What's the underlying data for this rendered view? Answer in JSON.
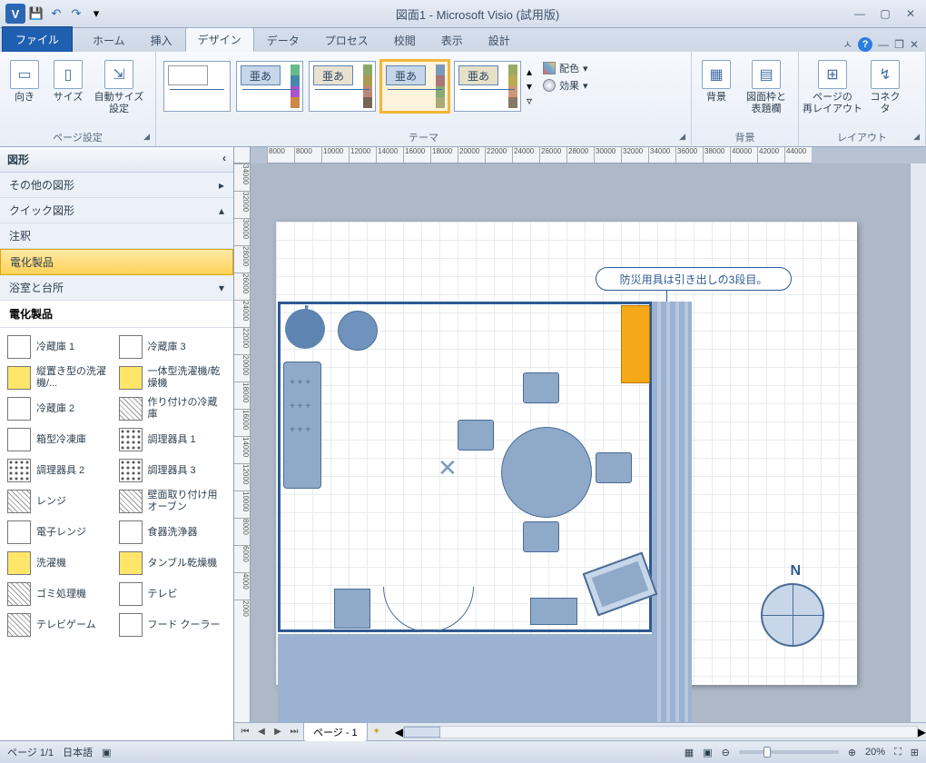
{
  "title": "図面1 - Microsoft Visio (試用版)",
  "qat": {
    "save": "💾",
    "undo": "↶",
    "redo": "↷"
  },
  "tabs": {
    "file": "ファイル",
    "home": "ホーム",
    "insert": "挿入",
    "design": "デザイン",
    "data": "データ",
    "process": "プロセス",
    "review": "校閲",
    "view": "表示",
    "plan": "設計"
  },
  "ribbon": {
    "pageSetup": {
      "orient": "向き",
      "size": "サイズ",
      "autosize": "自動サイズ\n設定",
      "group": "ページ設定"
    },
    "themes": {
      "aa": "亜あ",
      "group": "テーマ",
      "colors": "配色",
      "effects": "効果"
    },
    "background": {
      "bg": "背景",
      "border": "図面枠と\n表題欄",
      "group": "背景"
    },
    "layout": {
      "relayout": "ページの\n再レイアウト",
      "connector": "コネクタ",
      "group": "レイアウト"
    }
  },
  "shapesPane": {
    "title": "図形",
    "sections": {
      "other": "その他の図形",
      "quick": "クイック図形",
      "notes": "注釈",
      "elec": "電化製品",
      "bath": "浴室と台所"
    },
    "subtitle": "電化製品",
    "items": [
      [
        "冷蔵庫 1",
        "冷蔵庫 3"
      ],
      [
        "縦置き型の洗濯機/...",
        "一体型洗濯機/乾燥機"
      ],
      [
        "冷蔵庫 2",
        "作り付けの冷蔵庫"
      ],
      [
        "箱型冷凍庫",
        "調理器具 1"
      ],
      [
        "調理器具 2",
        "調理器具 3"
      ],
      [
        "レンジ",
        "壁面取り付け用オーブン"
      ],
      [
        "電子レンジ",
        "食器洗浄器"
      ],
      [
        "洗濯機",
        "タンブル乾燥機"
      ],
      [
        "ゴミ処理機",
        "テレビ"
      ],
      [
        "テレビゲーム",
        "フード クーラー"
      ]
    ]
  },
  "canvas": {
    "rulerH": [
      "8000",
      "8000",
      "10000",
      "12000",
      "14000",
      "16000",
      "18000",
      "20000",
      "22000",
      "24000",
      "26000",
      "28000",
      "30000",
      "32000",
      "34000",
      "36000",
      "38000",
      "40000",
      "42000",
      "44000"
    ],
    "rulerV": [
      "34000",
      "32000",
      "30000",
      "28000",
      "26000",
      "24000",
      "22000",
      "20000",
      "18000",
      "16000",
      "14000",
      "12000",
      "10000",
      "8000",
      "6000",
      "4000",
      "2000"
    ],
    "callout": "防災用具は引き出しの3段目。",
    "compass": "N",
    "sheetTab": "ページ - 1"
  },
  "status": {
    "page": "ページ 1/1",
    "lang": "日本語",
    "zoom": "20%"
  }
}
